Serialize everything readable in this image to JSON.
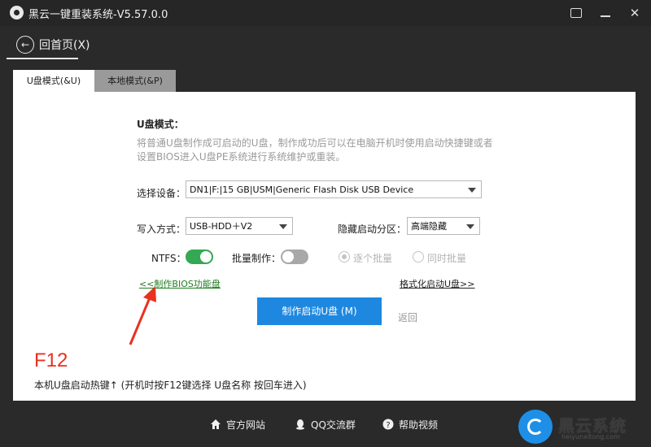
{
  "app": {
    "title": "黑云一键重装系统-V5.57.0.0"
  },
  "nav": {
    "back_label": "回首页(X)"
  },
  "tabs": [
    {
      "label": "U盘模式(&U)",
      "active": true
    },
    {
      "label": "本地模式(&P)",
      "active": false
    }
  ],
  "main": {
    "mode_title": "U盘模式：",
    "description": "将普通U盘制作成可启动的U盘，制作成功后可以在电脑开机时使用启动快捷键或者设置BIOS进入U盘PE系统进行系统维护或重装。",
    "device_label": "选择设备：",
    "device_value": "DN1|F:|15 GB|USM|Generic Flash Disk USB Device",
    "write_label": "写入方式：",
    "write_value": "USB-HDD＋V2",
    "hidden_label": "隐藏启动分区：",
    "hidden_value": "高端隐藏",
    "ntfs_label": "NTFS：",
    "ntfs_on": true,
    "batch_label": "批量制作：",
    "batch_on": false,
    "radio_one": "逐个批量",
    "radio_simul": "同时批量",
    "bios_link": "<<制作BIOS功能盘",
    "format_link": "格式化启动U盘>>",
    "make_button": "制作启动U盘 (M)",
    "return_label": "返回"
  },
  "hotkey": {
    "key": "F12",
    "hint": "本机U盘启动热键↑ (开机时按F12键选择 U盘名称 按回车进入)"
  },
  "footer": {
    "site": "官方网站",
    "qq": "QQ交流群",
    "video": "帮助视频"
  },
  "brand": {
    "text": "黑云系统",
    "sub": "heiyunxitong.com"
  },
  "colors": {
    "accent": "#1e88e0",
    "toggle_on": "#34a853",
    "hotkey": "#e8311f",
    "link_green": "#1e7d1e"
  }
}
